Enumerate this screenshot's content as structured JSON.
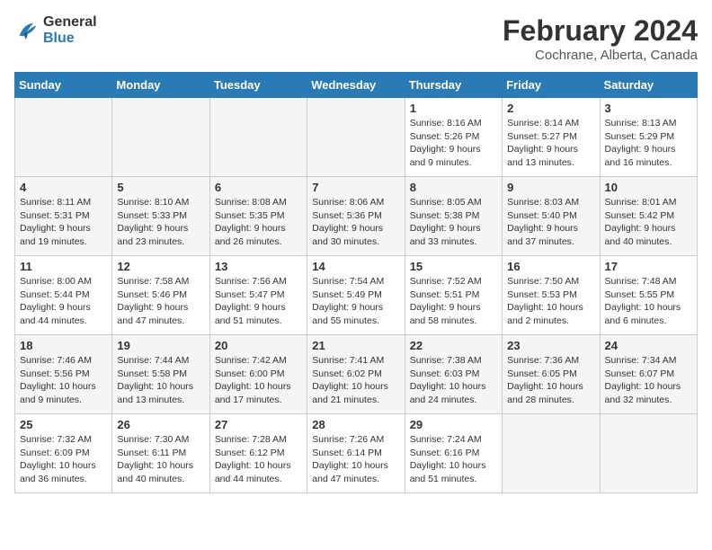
{
  "header": {
    "logo_line1": "General",
    "logo_line2": "Blue",
    "month_title": "February 2024",
    "location": "Cochrane, Alberta, Canada"
  },
  "weekdays": [
    "Sunday",
    "Monday",
    "Tuesday",
    "Wednesday",
    "Thursday",
    "Friday",
    "Saturday"
  ],
  "weeks": [
    [
      {
        "day": "",
        "info": ""
      },
      {
        "day": "",
        "info": ""
      },
      {
        "day": "",
        "info": ""
      },
      {
        "day": "",
        "info": ""
      },
      {
        "day": "1",
        "info": "Sunrise: 8:16 AM\nSunset: 5:26 PM\nDaylight: 9 hours\nand 9 minutes."
      },
      {
        "day": "2",
        "info": "Sunrise: 8:14 AM\nSunset: 5:27 PM\nDaylight: 9 hours\nand 13 minutes."
      },
      {
        "day": "3",
        "info": "Sunrise: 8:13 AM\nSunset: 5:29 PM\nDaylight: 9 hours\nand 16 minutes."
      }
    ],
    [
      {
        "day": "4",
        "info": "Sunrise: 8:11 AM\nSunset: 5:31 PM\nDaylight: 9 hours\nand 19 minutes."
      },
      {
        "day": "5",
        "info": "Sunrise: 8:10 AM\nSunset: 5:33 PM\nDaylight: 9 hours\nand 23 minutes."
      },
      {
        "day": "6",
        "info": "Sunrise: 8:08 AM\nSunset: 5:35 PM\nDaylight: 9 hours\nand 26 minutes."
      },
      {
        "day": "7",
        "info": "Sunrise: 8:06 AM\nSunset: 5:36 PM\nDaylight: 9 hours\nand 30 minutes."
      },
      {
        "day": "8",
        "info": "Sunrise: 8:05 AM\nSunset: 5:38 PM\nDaylight: 9 hours\nand 33 minutes."
      },
      {
        "day": "9",
        "info": "Sunrise: 8:03 AM\nSunset: 5:40 PM\nDaylight: 9 hours\nand 37 minutes."
      },
      {
        "day": "10",
        "info": "Sunrise: 8:01 AM\nSunset: 5:42 PM\nDaylight: 9 hours\nand 40 minutes."
      }
    ],
    [
      {
        "day": "11",
        "info": "Sunrise: 8:00 AM\nSunset: 5:44 PM\nDaylight: 9 hours\nand 44 minutes."
      },
      {
        "day": "12",
        "info": "Sunrise: 7:58 AM\nSunset: 5:46 PM\nDaylight: 9 hours\nand 47 minutes."
      },
      {
        "day": "13",
        "info": "Sunrise: 7:56 AM\nSunset: 5:47 PM\nDaylight: 9 hours\nand 51 minutes."
      },
      {
        "day": "14",
        "info": "Sunrise: 7:54 AM\nSunset: 5:49 PM\nDaylight: 9 hours\nand 55 minutes."
      },
      {
        "day": "15",
        "info": "Sunrise: 7:52 AM\nSunset: 5:51 PM\nDaylight: 9 hours\nand 58 minutes."
      },
      {
        "day": "16",
        "info": "Sunrise: 7:50 AM\nSunset: 5:53 PM\nDaylight: 10 hours\nand 2 minutes."
      },
      {
        "day": "17",
        "info": "Sunrise: 7:48 AM\nSunset: 5:55 PM\nDaylight: 10 hours\nand 6 minutes."
      }
    ],
    [
      {
        "day": "18",
        "info": "Sunrise: 7:46 AM\nSunset: 5:56 PM\nDaylight: 10 hours\nand 9 minutes."
      },
      {
        "day": "19",
        "info": "Sunrise: 7:44 AM\nSunset: 5:58 PM\nDaylight: 10 hours\nand 13 minutes."
      },
      {
        "day": "20",
        "info": "Sunrise: 7:42 AM\nSunset: 6:00 PM\nDaylight: 10 hours\nand 17 minutes."
      },
      {
        "day": "21",
        "info": "Sunrise: 7:41 AM\nSunset: 6:02 PM\nDaylight: 10 hours\nand 21 minutes."
      },
      {
        "day": "22",
        "info": "Sunrise: 7:38 AM\nSunset: 6:03 PM\nDaylight: 10 hours\nand 24 minutes."
      },
      {
        "day": "23",
        "info": "Sunrise: 7:36 AM\nSunset: 6:05 PM\nDaylight: 10 hours\nand 28 minutes."
      },
      {
        "day": "24",
        "info": "Sunrise: 7:34 AM\nSunset: 6:07 PM\nDaylight: 10 hours\nand 32 minutes."
      }
    ],
    [
      {
        "day": "25",
        "info": "Sunrise: 7:32 AM\nSunset: 6:09 PM\nDaylight: 10 hours\nand 36 minutes."
      },
      {
        "day": "26",
        "info": "Sunrise: 7:30 AM\nSunset: 6:11 PM\nDaylight: 10 hours\nand 40 minutes."
      },
      {
        "day": "27",
        "info": "Sunrise: 7:28 AM\nSunset: 6:12 PM\nDaylight: 10 hours\nand 44 minutes."
      },
      {
        "day": "28",
        "info": "Sunrise: 7:26 AM\nSunset: 6:14 PM\nDaylight: 10 hours\nand 47 minutes."
      },
      {
        "day": "29",
        "info": "Sunrise: 7:24 AM\nSunset: 6:16 PM\nDaylight: 10 hours\nand 51 minutes."
      },
      {
        "day": "",
        "info": ""
      },
      {
        "day": "",
        "info": ""
      }
    ]
  ]
}
